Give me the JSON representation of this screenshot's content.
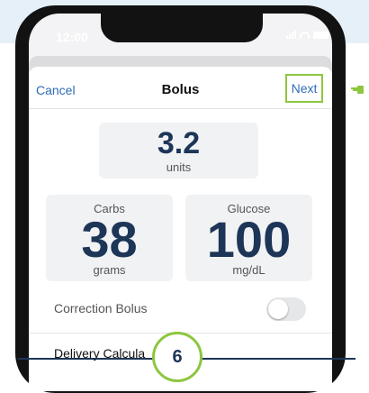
{
  "status_bar": {
    "time": "12:00"
  },
  "navbar": {
    "cancel_label": "Cancel",
    "title": "Bolus",
    "next_label": "Next"
  },
  "units_card": {
    "value": "3.2",
    "label": "units"
  },
  "carbs_card": {
    "label": "Carbs",
    "value": "38",
    "unit": "grams"
  },
  "glucose_card": {
    "label": "Glucose",
    "value": "100",
    "unit": "mg/dL"
  },
  "correction": {
    "label": "Correction Bolus",
    "enabled": false
  },
  "delivery": {
    "label": "Delivery Calcula"
  },
  "step": {
    "number": "6"
  },
  "colors": {
    "accent_green": "#8dc63f",
    "link_blue": "#2f6cb3",
    "value_navy": "#1d3557"
  },
  "icons": [
    "pointing-hand-icon",
    "signal-icon",
    "wifi-icon",
    "battery-icon"
  ]
}
